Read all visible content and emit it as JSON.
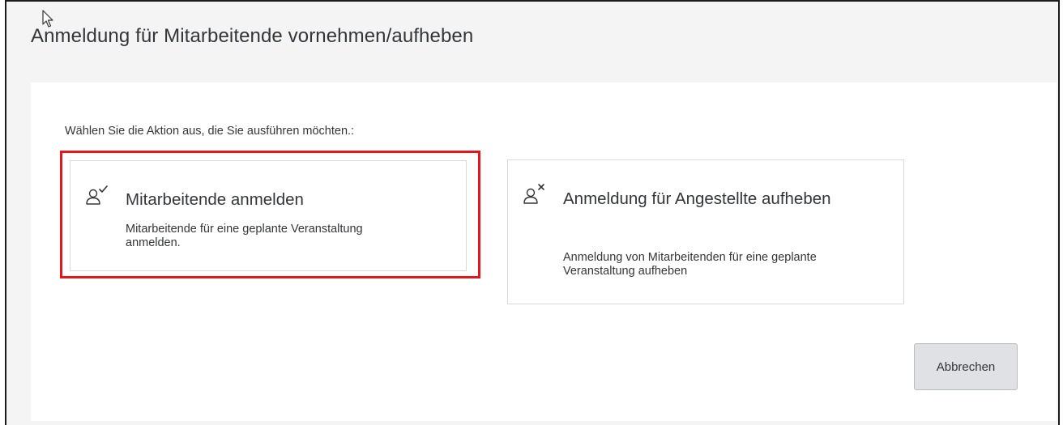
{
  "dialog": {
    "title": "Anmeldung für Mitarbeitende vornehmen/aufheben",
    "instruction": "Wählen Sie die Aktion aus, die Sie ausführen möchten.:",
    "actions": [
      {
        "title": "Mitarbeitende anmelden",
        "description": "Mitarbeitende für eine geplante Veranstaltung anmelden.",
        "icon": "person-check-icon",
        "highlighted": true
      },
      {
        "title": "Anmeldung für Angestellte aufheben",
        "description": "Anmeldung von Mitarbeitenden für eine geplante Veranstaltung aufheben",
        "icon": "person-remove-icon",
        "highlighted": false
      }
    ],
    "cancel_label": "Abbrechen"
  },
  "colors": {
    "highlight_border": "#e8141c",
    "background": "#f4f4f4",
    "text": "#32363a",
    "button_bg": "#dfe1e4"
  }
}
